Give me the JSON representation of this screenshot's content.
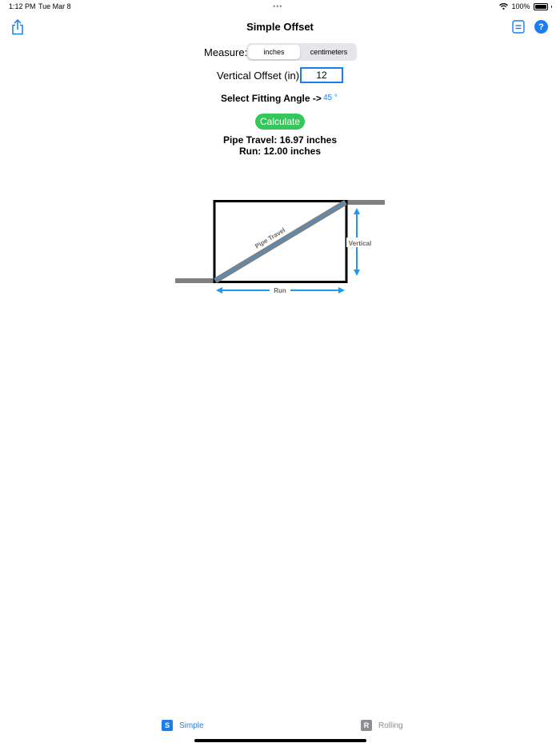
{
  "status_bar": {
    "time": "1:12 PM",
    "date": "Tue Mar 8",
    "dots": "•••",
    "battery": "100%"
  },
  "nav": {
    "title": "Simple Offset",
    "help_label": "?"
  },
  "measure": {
    "label": "Measure:",
    "options": [
      "inches",
      "centimeters"
    ],
    "selected": "inches"
  },
  "offset": {
    "label": "Vertical Offset (in):",
    "value": "12"
  },
  "angle": {
    "label": "Select Fitting Angle ->",
    "value": "45 °"
  },
  "calculate_label": "Calculate",
  "results": {
    "travel": "Pipe Travel: 16.97 inches",
    "run": "Run: 12.00 inches"
  },
  "diagram": {
    "travel_label": "Pipe Travel",
    "vertical_label": "Vertical",
    "run_label": "Run"
  },
  "tabs": [
    {
      "badge": "S",
      "label": "Simple",
      "active": true
    },
    {
      "badge": "R",
      "label": "Rolling",
      "active": false
    }
  ],
  "colors": {
    "accent": "#1a7ef2",
    "calculate": "#34c759",
    "pipe": "#808080",
    "arrow": "#1a9af0"
  },
  "icons": [
    "share-icon",
    "list-icon",
    "help-icon",
    "wifi-icon",
    "battery-icon"
  ]
}
